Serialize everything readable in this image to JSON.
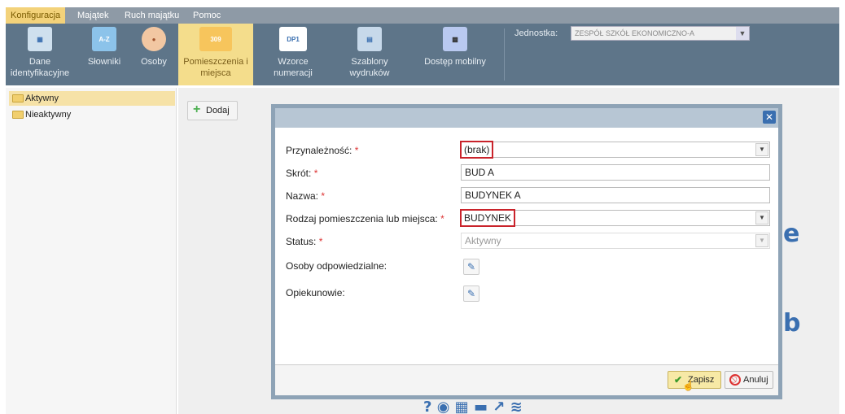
{
  "menu": {
    "tabs": [
      {
        "label": "Konfiguracja",
        "active": true
      },
      {
        "label": "Majątek",
        "active": false
      },
      {
        "label": "Ruch majątku",
        "active": false
      },
      {
        "label": "Pomoc",
        "active": false
      }
    ]
  },
  "toolbar": {
    "buttons": [
      {
        "label": "Dane\nidentyfikacyjne",
        "icon": "grid-icon",
        "active": false
      },
      {
        "label": "Słowniki",
        "icon": "dictionary-icon",
        "active": false
      },
      {
        "label": "Osoby",
        "icon": "person-icon",
        "active": false
      },
      {
        "label": "Pomieszczenia i\nmiejsca",
        "icon": "room-icon",
        "icon_text": "309",
        "active": true
      },
      {
        "label": "Wzorce\nnumeracji",
        "icon": "numbering-icon",
        "icon_text": "DP1",
        "active": false
      },
      {
        "label": "Szablony\nwydruków",
        "icon": "template-icon",
        "active": false
      },
      {
        "label": "Dostęp mobilny",
        "icon": "qr-icon",
        "active": false
      }
    ],
    "jednostka_label": "Jednostka:",
    "jednostka_value": "ZESPÓŁ SZKÓŁ EKONOMICZNO-A"
  },
  "tree": {
    "items": [
      {
        "label": "Aktywny",
        "selected": true
      },
      {
        "label": "Nieaktywny",
        "selected": false
      }
    ]
  },
  "actions": {
    "dodaj_label": "Dodaj"
  },
  "modal": {
    "close_glyph": "✕",
    "fields": {
      "przynaleznosc_label": "Przynależność:",
      "przynaleznosc_value": "(brak)",
      "skrot_label": "Skrót:",
      "skrot_value": "BUD A",
      "nazwa_label": "Nazwa:",
      "nazwa_value": "BUDYNEK A",
      "rodzaj_label": "Rodzaj pomieszczenia lub miejsca:",
      "rodzaj_value": "BUDYNEK",
      "status_label": "Status:",
      "status_value": "Aktywny",
      "osoby_label": "Osoby odpowiedzialne:",
      "opiekunowie_label": "Opiekunowie:"
    },
    "required_marker": "*",
    "zapisz_label": "Zapisz",
    "anuluj_label": "Anuluj"
  },
  "colors": {
    "menubar": "#8e9aa6",
    "toolbar": "#5e7589",
    "active_tab": "#f3d27a",
    "highlight_border": "#c9232b",
    "modal_border": "#8ea3b6"
  }
}
